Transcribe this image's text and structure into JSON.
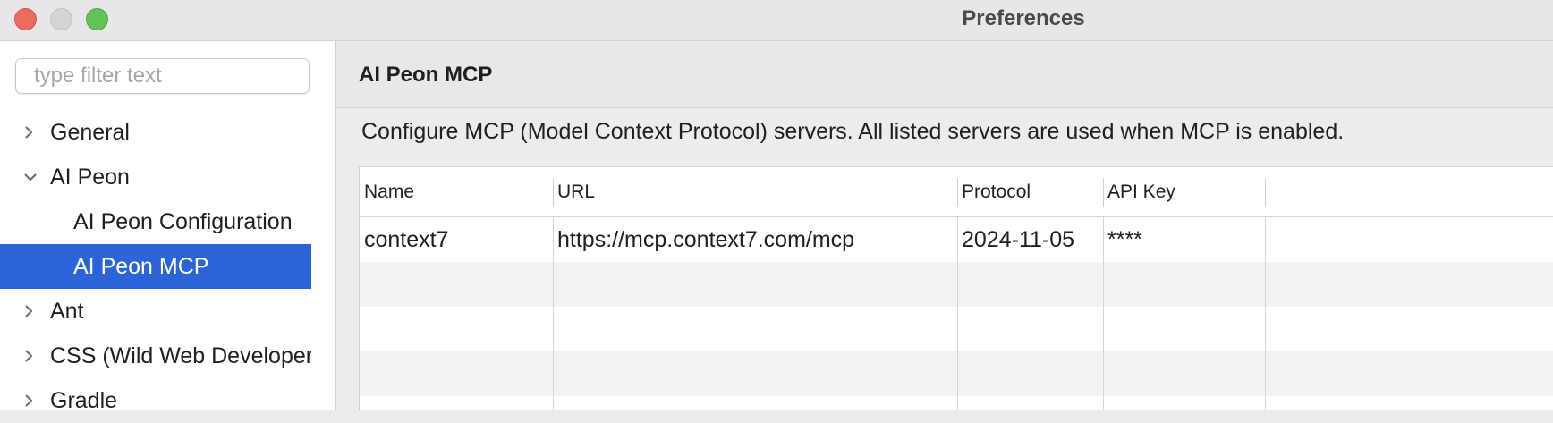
{
  "window": {
    "title": "Preferences"
  },
  "sidebar": {
    "filter_placeholder": "type filter text",
    "items": [
      {
        "label": "General",
        "expanded": false,
        "icon": "chevron-right-icon"
      },
      {
        "label": "AI Peon",
        "expanded": true,
        "icon": "chevron-down-icon"
      },
      {
        "label": "AI Peon Configuration"
      },
      {
        "label": "AI Peon MCP",
        "selected": true
      },
      {
        "label": "Ant",
        "expanded": false,
        "icon": "chevron-right-icon"
      },
      {
        "label": "CSS (Wild Web Developer)",
        "expanded": false,
        "icon": "chevron-right-icon"
      },
      {
        "label": "Gradle",
        "expanded": false,
        "icon": "chevron-right-icon"
      }
    ]
  },
  "main": {
    "title": "AI Peon MCP",
    "description": "Configure MCP (Model Context Protocol) servers. All listed servers are used when MCP is enabled.",
    "table": {
      "columns": [
        "Name",
        "URL",
        "Protocol",
        "API Key"
      ],
      "rows": [
        {
          "name": "context7",
          "url": "https://mcp.context7.com/mcp",
          "protocol": "2024-11-05",
          "api_key": "****"
        }
      ]
    }
  },
  "colors": {
    "selection": "#2b63d9",
    "close": "#ed6a5e",
    "minimize": "#d4d4d4",
    "maximize": "#61c454"
  }
}
